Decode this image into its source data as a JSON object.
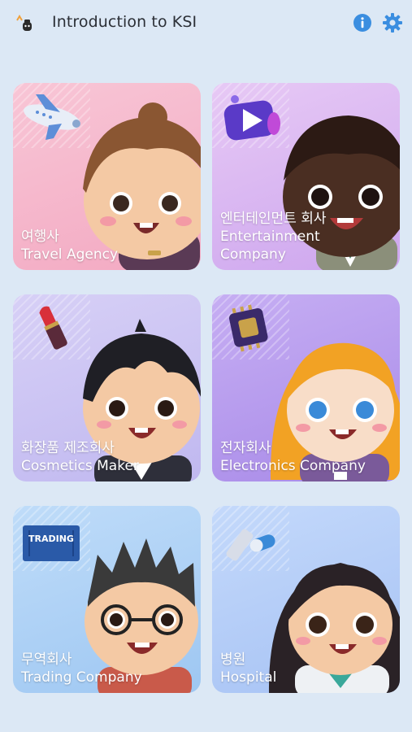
{
  "header": {
    "title": "Introduction to KSI",
    "logo_icon": "ksi-character-logo",
    "info_icon": "info-icon",
    "settings_icon": "gear-icon",
    "accent": "#3b8ee0"
  },
  "cards": [
    {
      "label_ko": "여행사",
      "label_en": "Travel Agency",
      "icon": "airplane-icon",
      "color": "#f3a9c2"
    },
    {
      "label_ko": "엔터테인먼트 회사",
      "label_en": "Entertainment",
      "label_en2": "Company",
      "icon": "video-play-icon",
      "color": "#cda6ee"
    },
    {
      "label_ko": "화장품 제조회사",
      "label_en": "Cosmetics Maker",
      "icon": "lipstick-icon",
      "color": "#c0b8f0"
    },
    {
      "label_ko": "전자회사",
      "label_en": "Electronics Company",
      "icon": "microchip-icon",
      "color": "#a88ae8"
    },
    {
      "label_ko": "무역회사",
      "label_en": "Trading Company",
      "icon": "shipping-container-icon",
      "container_text": "TRADING",
      "color": "#9ec7f2"
    },
    {
      "label_ko": "병원",
      "label_en": "Hospital",
      "icon": "medicine-icon",
      "color": "#a6c2f4"
    }
  ]
}
